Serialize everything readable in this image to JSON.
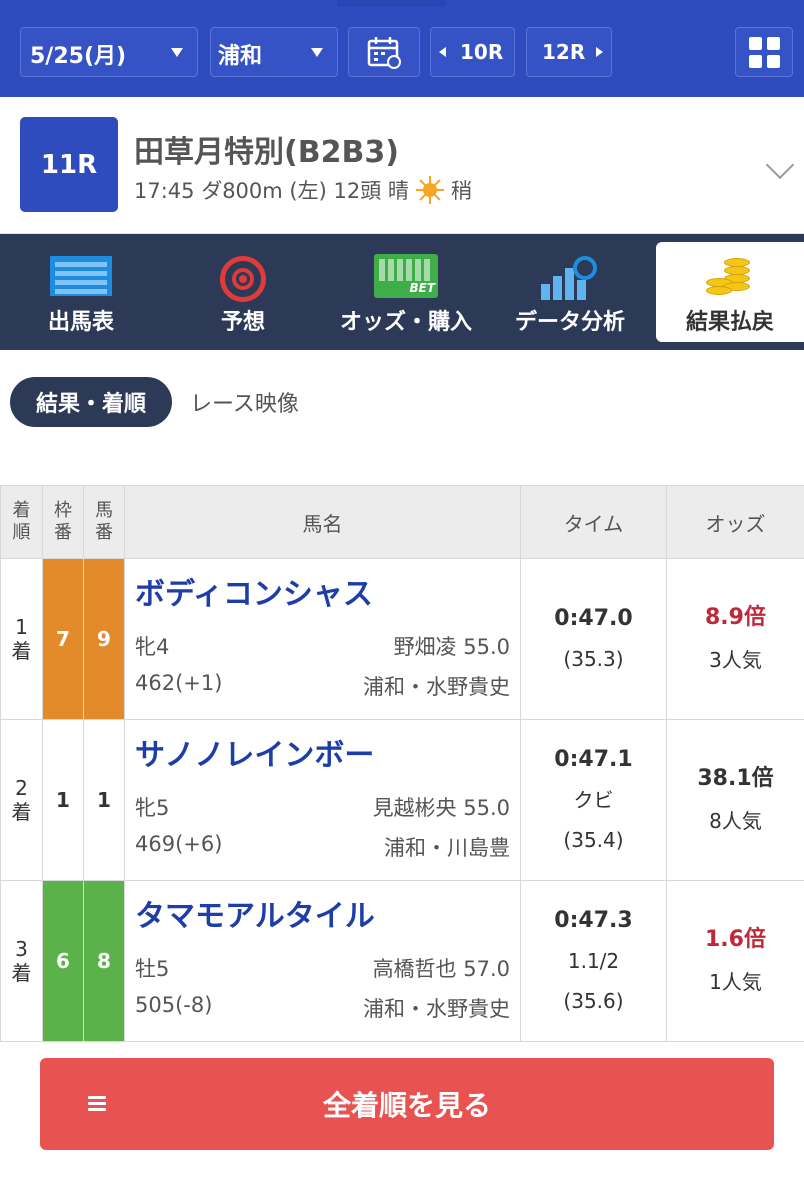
{
  "topbar": {
    "date": "5/25(月)",
    "track": "浦和",
    "prev": "10R",
    "next": "12R"
  },
  "race": {
    "number": "11R",
    "name": "田草月特別(B2B3)",
    "info_pre": "17:45 ダ800m (左) 12頭 晴",
    "info_post": "稍"
  },
  "tabs": [
    {
      "label": "出馬表"
    },
    {
      "label": "予想"
    },
    {
      "label": "オッズ・購入"
    },
    {
      "label": "データ分析"
    },
    {
      "label": "結果払戻"
    }
  ],
  "subtabs": {
    "active": "結果・着順",
    "other": "レース映像"
  },
  "table": {
    "headers": {
      "rank": "着\n順",
      "frame": "枠\n番",
      "horse_no": "馬\n番",
      "name": "馬名",
      "time": "タイム",
      "odds": "オッズ"
    },
    "rows": [
      {
        "rank": "1\n着",
        "frame": "7",
        "horse_no": "9",
        "frame_color": "#e38a2b",
        "name": "ボディコンシャス",
        "sexage": "牝4",
        "jockey": "野畑凌 55.0",
        "weight": "462(+1)",
        "trainer": "浦和・水野貴史",
        "time": "0:47.0",
        "margin": "",
        "last3f": "(35.3)",
        "odds": "8.9倍",
        "odds_color": "#c0283a",
        "pop": "3人気"
      },
      {
        "rank": "2\n着",
        "frame": "1",
        "horse_no": "1",
        "frame_color": "#ffffff",
        "name": "サノノレインボー",
        "sexage": "牝5",
        "jockey": "見越彬央 55.0",
        "weight": "469(+6)",
        "trainer": "浦和・川島豊",
        "time": "0:47.1",
        "margin": "クビ",
        "last3f": "(35.4)",
        "odds": "38.1倍",
        "odds_color": "#555555",
        "pop": "8人気"
      },
      {
        "rank": "3\n着",
        "frame": "6",
        "horse_no": "8",
        "frame_color": "#5bb24a",
        "name": "タマモアルタイル",
        "sexage": "牡5",
        "jockey": "高橋哲也 57.0",
        "weight": "505(-8)",
        "trainer": "浦和・水野貴史",
        "time": "0:47.3",
        "margin": "1.1/2",
        "last3f": "(35.6)",
        "odds": "1.6倍",
        "odds_color": "#c0283a",
        "pop": "1人気"
      }
    ]
  },
  "button": {
    "label": "全着順を見る"
  },
  "colors": {
    "nav_blue": "#2f4cbf",
    "tab_dark": "#2d3a57",
    "horse_name_blue": "#1d3da8",
    "odds_red": "#c0283a",
    "button_red": "#e85351"
  }
}
